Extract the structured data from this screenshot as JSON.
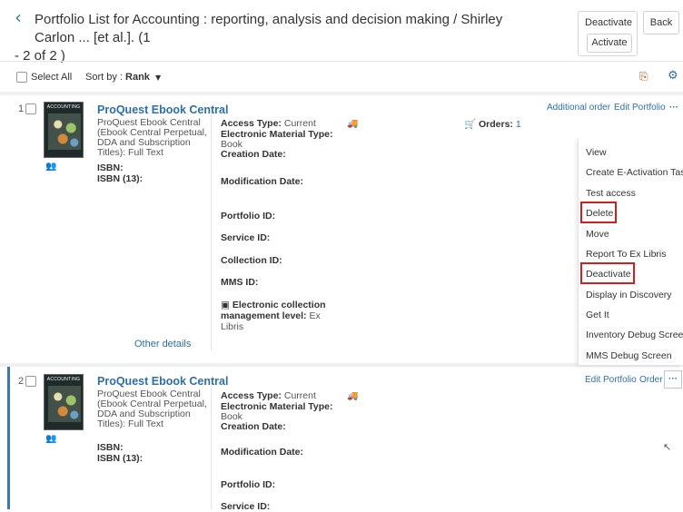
{
  "header": {
    "back_icon": "chevron-left-icon",
    "title": "Portfolio List for Accounting : reporting, analysis and decision making / Shirley Carlon ... [et al.]. (1 - 2 of 2 )",
    "title_line1": "Portfolio List for Accounting : reporting, analysis and decision making / Shirley Carlon ... [et al.]. (1",
    "title_line2": "- 2 of 2 )",
    "deactivate_label": "Deactivate",
    "activate_label": "Activate",
    "back_label": "Back"
  },
  "toolbar": {
    "select_all_label": "Select All",
    "sort_label": "Sort by :",
    "sort_value": "Rank",
    "export_icon": "export-icon",
    "settings_icon": "gear-icon"
  },
  "rows": [
    {
      "number": "1",
      "title": "ProQuest Ebook Central",
      "desc_lines": [
        "ProQuest Ebook Central",
        "(Ebook Central Perpetual,",
        "DDA and Subscription",
        "Titles): Full Text"
      ],
      "isbn_label": "ISBN:",
      "isbn13_label": "ISBN (13):",
      "access_type_label": "Access Type:",
      "access_type_value": "Current",
      "material_type_label_1": "Electronic Material Type:",
      "material_type_value": "Book",
      "creation_date_label": "Creation Date:",
      "modification_date_label": "Modification Date:",
      "portfolio_id_label": "Portfolio ID:",
      "service_id_label": "Service ID:",
      "collection_id_label": "Collection ID:",
      "mms_id_label": "MMS ID:",
      "collection_level_label_1": "Electronic collection",
      "collection_level_label_2": "management level:",
      "collection_level_value_1": "Ex",
      "collection_level_value_2": "Libris",
      "orders_label": "Orders:",
      "orders_count": "1",
      "other_details": "Other details",
      "actions": [
        "Additional order",
        "Edit Portfolio",
        "···"
      ]
    },
    {
      "number": "2",
      "title": "ProQuest Ebook Central",
      "desc_lines": [
        "ProQuest Ebook Central",
        "(Ebook Central Perpetual,",
        "DDA and Subscription",
        "Titles): Full Text"
      ],
      "isbn_label": "ISBN:",
      "isbn13_label": "ISBN (13):",
      "access_type_label": "Access Type:",
      "access_type_value": "Current",
      "material_type_label_1": "Electronic Material Type:",
      "material_type_value": "Book",
      "creation_date_label": "Creation Date:",
      "modification_date_label": "Modification Date:",
      "portfolio_id_label": "Portfolio ID:",
      "service_id_label": "Service ID:",
      "actions": [
        "Edit Portfolio",
        "Order",
        "···"
      ]
    }
  ],
  "menu": {
    "items": [
      "View",
      "Create E-Activation Task",
      "Test access",
      "Delete",
      "Move",
      "Report To Ex Libris",
      "Deactivate",
      "Display in Discovery",
      "Get It",
      "Inventory Debug Screen",
      "MMS Debug Screen"
    ],
    "highlighted": [
      "Delete",
      "Deactivate"
    ],
    "highlight_color": "#d0201c"
  },
  "colors": {
    "accent": "#2d6fa6",
    "highlight": "#d0201c"
  }
}
